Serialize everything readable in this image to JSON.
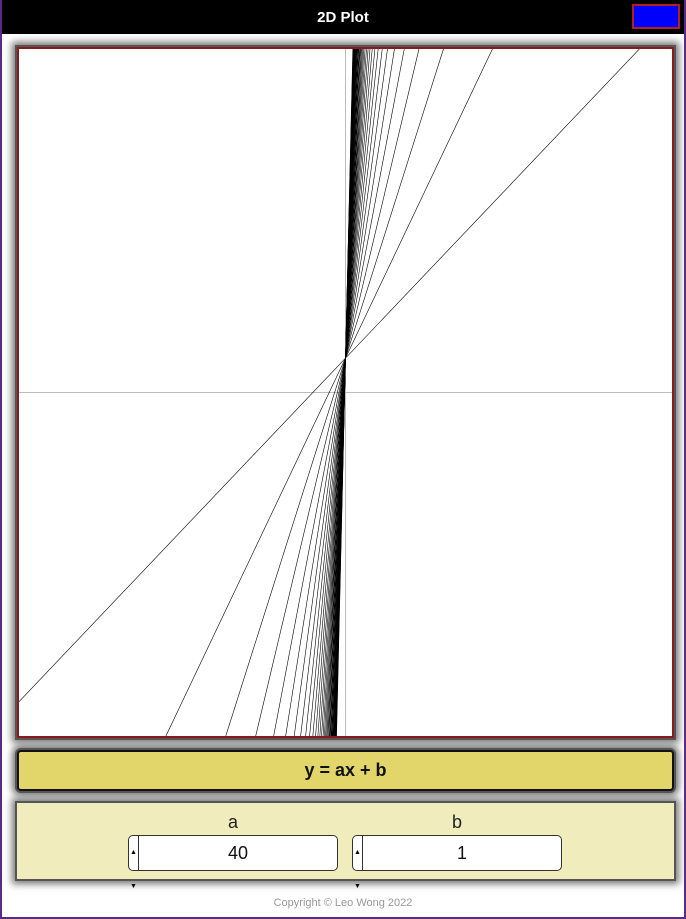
{
  "app": {
    "title": "2D Plot",
    "swatch_color": "#0000ff"
  },
  "formula": "y = ax + b",
  "params": [
    {
      "label": "a",
      "value": "40"
    },
    {
      "label": "b",
      "value": "1"
    }
  ],
  "footer": {
    "copyright": "Copyright © Leo Wong 2022"
  },
  "chart_data": {
    "type": "line",
    "title": "",
    "xlabel": "",
    "ylabel": "",
    "xlim": [
      -10,
      10
    ],
    "ylim": [
      -10,
      10
    ],
    "grid": false,
    "axes_color": "#bbbbbb",
    "line_color": "#000000",
    "series_rule": "y = a*x + b for a = 1..40, b = 1",
    "a_values": [
      1,
      2,
      3,
      4,
      5,
      6,
      7,
      8,
      9,
      10,
      11,
      12,
      13,
      14,
      15,
      16,
      17,
      18,
      19,
      20,
      21,
      22,
      23,
      24,
      25,
      26,
      27,
      28,
      29,
      30,
      31,
      32,
      33,
      34,
      35,
      36,
      37,
      38,
      39,
      40
    ],
    "b": 1
  }
}
